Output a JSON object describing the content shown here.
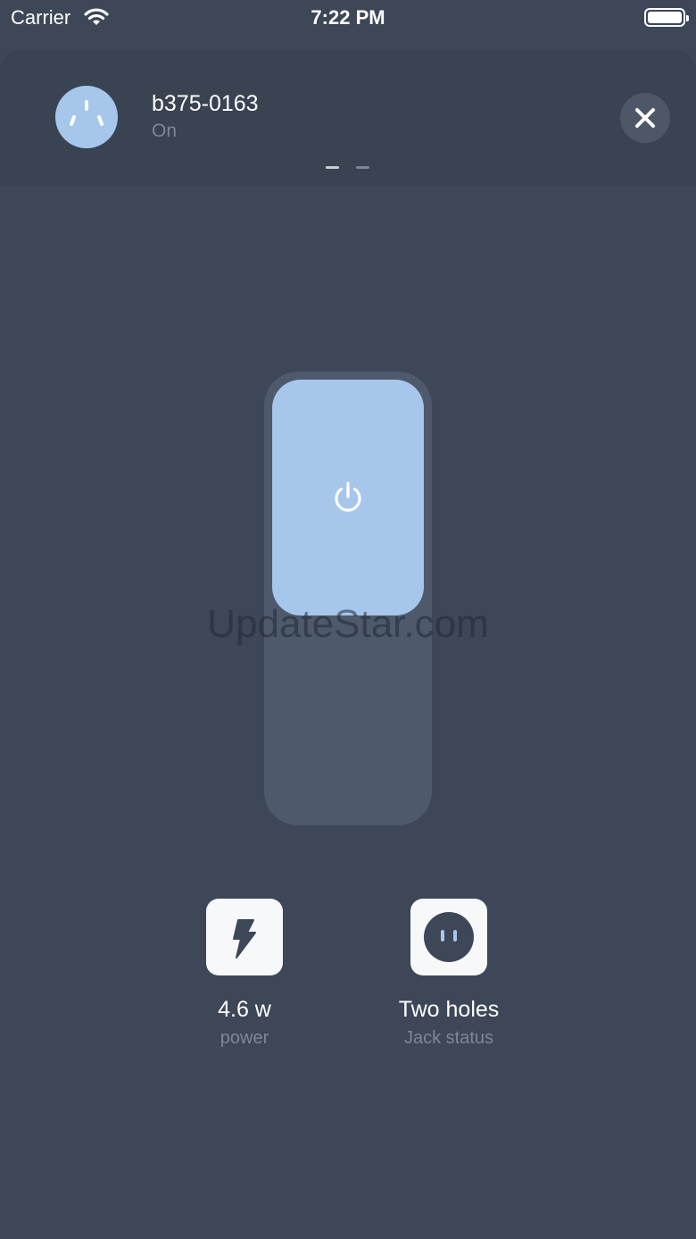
{
  "status_bar": {
    "carrier": "Carrier",
    "time": "7:22 PM",
    "wifi_icon": "wifi-icon",
    "battery_icon": "battery-full-icon"
  },
  "header": {
    "device_icon": "socket-icon",
    "device_name": "b375-0163",
    "device_state": "On",
    "close_icon": "close-icon",
    "pages": 2,
    "active_page": 1
  },
  "switch": {
    "state": "on",
    "icon": "power-icon",
    "accent_color": "#a6c6ec"
  },
  "watermark": "UpdateStar.com",
  "stats": [
    {
      "icon": "lightning-bolt-icon",
      "value": "4.6 w",
      "label": "power"
    },
    {
      "icon": "two-hole-socket-icon",
      "value": "Two holes",
      "label": "Jack status"
    }
  ],
  "colors": {
    "background": "#3d4757",
    "header": "#394352",
    "accent": "#a6c6ec",
    "muted_text": "#7d8797"
  }
}
